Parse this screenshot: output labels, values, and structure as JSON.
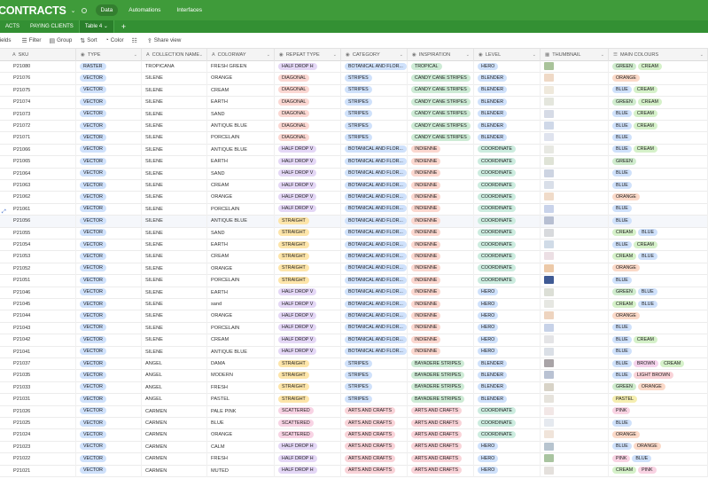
{
  "app": {
    "title": "CONTRACTS",
    "tabs": [
      "Data",
      "Automations",
      "Interfaces"
    ],
    "active_tab": "Data"
  },
  "tables": {
    "items": [
      "ACTS",
      "PAYING CLIENTS",
      "Table 4"
    ],
    "selected": "Table 4",
    "add_label": "+"
  },
  "toolbar": {
    "fields": "fields",
    "filter": "Filter",
    "group": "Group",
    "sort": "Sort",
    "color": "Color",
    "share": "Share view"
  },
  "columns": [
    {
      "key": "sku",
      "label": "SKU",
      "icon": "A"
    },
    {
      "key": "type",
      "label": "TYPE",
      "icon": "◉"
    },
    {
      "key": "collection",
      "label": "COLLECTION NAME",
      "icon": "A"
    },
    {
      "key": "colorway",
      "label": "COLORWAY",
      "icon": "A"
    },
    {
      "key": "repeat",
      "label": "REPEAT TYPE",
      "icon": "◉"
    },
    {
      "key": "category",
      "label": "CATEGORY",
      "icon": "◉"
    },
    {
      "key": "inspiration",
      "label": "INSPIRATION",
      "icon": "◉"
    },
    {
      "key": "level",
      "label": "LEVEL",
      "icon": "◉"
    },
    {
      "key": "thumbnail",
      "label": "THUMBNAIL",
      "icon": "▦"
    },
    {
      "key": "colours",
      "label": "MAIN COLOURS",
      "icon": "☰"
    }
  ],
  "rows": [
    {
      "sku": "P21080",
      "type": "RASTER",
      "collection": "TROPICANA",
      "colorway": "FRESH GREEN",
      "repeat": "HALF DROP H",
      "category": "BOTANICAL AND FLOR...",
      "inspiration": "TROPICAL",
      "level": "HERO",
      "thumb": "#a9c39a",
      "colours": [
        "GREEN",
        "CREAM"
      ]
    },
    {
      "sku": "P21076",
      "type": "VECTOR",
      "collection": "SILENE",
      "colorway": "ORANGE",
      "repeat": "DIAGONAL",
      "category": "STRIPES",
      "inspiration": "CANDY CANE STRIPES",
      "level": "BLENDER",
      "thumb": "#efd9c6",
      "colours": [
        "ORANGE"
      ]
    },
    {
      "sku": "P21075",
      "type": "VECTOR",
      "collection": "SILENE",
      "colorway": "CREAM",
      "repeat": "DIAGONAL",
      "category": "STRIPES",
      "inspiration": "CANDY CANE STRIPES",
      "level": "BLENDER",
      "thumb": "#efe9dc",
      "colours": [
        "BLUE",
        "CREAM"
      ]
    },
    {
      "sku": "P21074",
      "type": "VECTOR",
      "collection": "SILENE",
      "colorway": "EARTH",
      "repeat": "DIAGONAL",
      "category": "STRIPES",
      "inspiration": "CANDY CANE STRIPES",
      "level": "BLENDER",
      "thumb": "#e4e6dd",
      "colours": [
        "GREEN",
        "CREAM"
      ]
    },
    {
      "sku": "P21073",
      "type": "VECTOR",
      "collection": "SILENE",
      "colorway": "SAND",
      "repeat": "DIAGONAL",
      "category": "STRIPES",
      "inspiration": "CANDY CANE STRIPES",
      "level": "BLENDER",
      "thumb": "#d6dbe6",
      "colours": [
        "BLUE",
        "CREAM"
      ]
    },
    {
      "sku": "P21072",
      "type": "VECTOR",
      "collection": "SILENE",
      "colorway": "ANTIQUE BLUE",
      "repeat": "DIAGONAL",
      "category": "STRIPES",
      "inspiration": "CANDY CANE STRIPES",
      "level": "BLENDER",
      "thumb": "#cfd8e8",
      "colours": [
        "BLUE",
        "CREAM"
      ]
    },
    {
      "sku": "P21071",
      "type": "VECTOR",
      "collection": "SILENE",
      "colorway": "PORCELAIN",
      "repeat": "DIAGONAL",
      "category": "STRIPES",
      "inspiration": "CANDY CANE STRIPES",
      "level": "BLENDER",
      "thumb": "#dfe3ee",
      "colours": [
        "BLUE"
      ]
    },
    {
      "sku": "P21066",
      "type": "VECTOR",
      "collection": "SILENE",
      "colorway": "ANTIQUE BLUE",
      "repeat": "HALF DROP V",
      "category": "BOTANICAL AND FLOR...",
      "inspiration": "INDIENNE",
      "level": "COORDINATE",
      "thumb": "#e7e8e2",
      "colours": [
        "BLUE",
        "CREAM"
      ]
    },
    {
      "sku": "P21065",
      "type": "VECTOR",
      "collection": "SILENE",
      "colorway": "EARTH",
      "repeat": "HALF DROP V",
      "category": "BOTANICAL AND FLOR...",
      "inspiration": "INDIENNE",
      "level": "COORDINATE",
      "thumb": "#dfe3d6",
      "colours": [
        "GREEN"
      ]
    },
    {
      "sku": "P21064",
      "type": "VECTOR",
      "collection": "SILENE",
      "colorway": "SAND",
      "repeat": "HALF DROP V",
      "category": "BOTANICAL AND FLOR...",
      "inspiration": "INDIENNE",
      "level": "COORDINATE",
      "thumb": "#cdd4e2",
      "colours": [
        "BLUE"
      ]
    },
    {
      "sku": "P21063",
      "type": "VECTOR",
      "collection": "SILENE",
      "colorway": "CREAM",
      "repeat": "HALF DROP V",
      "category": "BOTANICAL AND FLOR...",
      "inspiration": "INDIENNE",
      "level": "COORDINATE",
      "thumb": "#d9dfe9",
      "colours": [
        "BLUE"
      ]
    },
    {
      "sku": "P21062",
      "type": "VECTOR",
      "collection": "SILENE",
      "colorway": "ORANGE",
      "repeat": "HALF DROP V",
      "category": "BOTANICAL AND FLOR...",
      "inspiration": "INDIENNE",
      "level": "COORDINATE",
      "thumb": "#f0dbc9",
      "colours": [
        "ORANGE"
      ]
    },
    {
      "sku": "P21061",
      "type": "VECTOR",
      "collection": "SILENE",
      "colorway": "PORCELAIN",
      "repeat": "HALF DROP V",
      "category": "BOTANICAL AND FLOR...",
      "inspiration": "INDIENNE",
      "level": "COORDINATE",
      "thumb": "#c9d3ea",
      "colours": [
        "BLUE"
      ]
    },
    {
      "sku": "P21056",
      "type": "VECTOR",
      "collection": "SILENE",
      "colorway": "ANTIQUE BLUE",
      "repeat": "STRAIGHT",
      "category": "BOTANICAL AND FLOR...",
      "inspiration": "INDIENNE",
      "level": "COORDINATE",
      "thumb": "#b7bfd2",
      "colours": [
        "BLUE"
      ]
    },
    {
      "sku": "P21055",
      "type": "VECTOR",
      "collection": "SILENE",
      "colorway": "SAND",
      "repeat": "STRAIGHT",
      "category": "BOTANICAL AND FLOR...",
      "inspiration": "INDIENNE",
      "level": "COORDINATE",
      "thumb": "#d8dadd",
      "colours": [
        "CREAM",
        "BLUE"
      ]
    },
    {
      "sku": "P21054",
      "type": "VECTOR",
      "collection": "SILENE",
      "colorway": "EARTH",
      "repeat": "STRAIGHT",
      "category": "BOTANICAL AND FLOR...",
      "inspiration": "INDIENNE",
      "level": "COORDINATE",
      "thumb": "#d0dbe7",
      "colours": [
        "BLUE",
        "CREAM"
      ]
    },
    {
      "sku": "P21053",
      "type": "VECTOR",
      "collection": "SILENE",
      "colorway": "CREAM",
      "repeat": "STRAIGHT",
      "category": "BOTANICAL AND FLOR...",
      "inspiration": "INDIENNE",
      "level": "COORDINATE",
      "thumb": "#ecdfe4",
      "colours": [
        "CREAM",
        "BLUE"
      ]
    },
    {
      "sku": "P21052",
      "type": "VECTOR",
      "collection": "SILENE",
      "colorway": "ORANGE",
      "repeat": "STRAIGHT",
      "category": "BOTANICAL AND FLOR...",
      "inspiration": "INDIENNE",
      "level": "COORDINATE",
      "thumb": "#ecc9a8",
      "colours": [
        "ORANGE"
      ]
    },
    {
      "sku": "P21051",
      "type": "VECTOR",
      "collection": "SILENE",
      "colorway": "PORCELAIN",
      "repeat": "STRAIGHT",
      "category": "BOTANICAL AND FLOR...",
      "inspiration": "INDIENNE",
      "level": "COORDINATE",
      "thumb": "#3f5a94",
      "colours": [
        "BLUE"
      ]
    },
    {
      "sku": "P21046",
      "type": "VECTOR",
      "collection": "SILENE",
      "colorway": "EARTH",
      "repeat": "HALF DROP V",
      "category": "BOTANICAL AND FLOR...",
      "inspiration": "INDIENNE",
      "level": "HERO",
      "thumb": "#dcdfd6",
      "colours": [
        "GREEN",
        "BLUE"
      ]
    },
    {
      "sku": "P21045",
      "type": "VECTOR",
      "collection": "SILENE",
      "colorway": "sand",
      "repeat": "HALF DROP V",
      "category": "BOTANICAL AND FLOR...",
      "inspiration": "INDIENNE",
      "level": "HERO",
      "thumb": "#e6e7e2",
      "colours": [
        "CREAM",
        "BLUE"
      ]
    },
    {
      "sku": "P21044",
      "type": "VECTOR",
      "collection": "SILENE",
      "colorway": "ORANGE",
      "repeat": "HALF DROP V",
      "category": "BOTANICAL AND FLOR...",
      "inspiration": "INDIENNE",
      "level": "HERO",
      "thumb": "#eed4bf",
      "colours": [
        "ORANGE"
      ]
    },
    {
      "sku": "P21043",
      "type": "VECTOR",
      "collection": "SILENE",
      "colorway": "PORCELAIN",
      "repeat": "HALF DROP V",
      "category": "BOTANICAL AND FLOR...",
      "inspiration": "INDIENNE",
      "level": "HERO",
      "thumb": "#c7d2e8",
      "colours": [
        "BLUE"
      ]
    },
    {
      "sku": "P21042",
      "type": "VECTOR",
      "collection": "SILENE",
      "colorway": "CREAM",
      "repeat": "HALF DROP V",
      "category": "BOTANICAL AND FLOR...",
      "inspiration": "INDIENNE",
      "level": "HERO",
      "thumb": "#e4e4e6",
      "colours": [
        "BLUE",
        "CREAM"
      ]
    },
    {
      "sku": "P21041",
      "type": "VECTOR",
      "collection": "SILENE",
      "colorway": "ANTIQUE BLUE",
      "repeat": "HALF DROP V",
      "category": "BOTANICAL AND FLOR...",
      "inspiration": "INDIENNE",
      "level": "HERO",
      "thumb": "#dadfe6",
      "colours": [
        "BLUE"
      ]
    },
    {
      "sku": "P21037",
      "type": "VECTOR",
      "collection": "ANGEL",
      "colorway": "DAMA",
      "repeat": "STRAIGHT",
      "category": "STRIPES",
      "inspiration": "BAYADERE STRIPES",
      "level": "BLENDER",
      "thumb": "#a9a4a7",
      "colours": [
        "BLUE",
        "BROWN",
        "CREAM"
      ]
    },
    {
      "sku": "P21035",
      "type": "VECTOR",
      "collection": "ANGEL",
      "colorway": "MODERN",
      "repeat": "STRAIGHT",
      "category": "STRIPES",
      "inspiration": "BAYADERE STRIPES",
      "level": "BLENDER",
      "thumb": "#b9c2d3",
      "colours": [
        "BLUE",
        "LIGHT BROWN"
      ]
    },
    {
      "sku": "P21033",
      "type": "VECTOR",
      "collection": "ANGEL",
      "colorway": "FRESH",
      "repeat": "STRAIGHT",
      "category": "STRIPES",
      "inspiration": "BAYADERE STRIPES",
      "level": "BLENDER",
      "thumb": "#d8d3c7",
      "colours": [
        "GREEN",
        "ORANGE"
      ]
    },
    {
      "sku": "P21031",
      "type": "VECTOR",
      "collection": "ANGEL",
      "colorway": "PASTEL",
      "repeat": "STRAIGHT",
      "category": "STRIPES",
      "inspiration": "BAYADERE STRIPES",
      "level": "BLENDER",
      "thumb": "#e6e3dc",
      "colours": [
        "PASTEL"
      ]
    },
    {
      "sku": "P21026",
      "type": "VECTOR",
      "collection": "CARMEN",
      "colorway": "PALE PINK",
      "repeat": "SCATTERED",
      "category": "ARTS AND CRAFTS",
      "inspiration": "ARTS AND CRAFTS",
      "level": "COORDINATE",
      "thumb": "#f2e7e6",
      "colours": [
        "PINK"
      ]
    },
    {
      "sku": "P21025",
      "type": "VECTOR",
      "collection": "CARMEN",
      "colorway": "BLUE",
      "repeat": "SCATTERED",
      "category": "ARTS AND CRAFTS",
      "inspiration": "ARTS AND CRAFTS",
      "level": "COORDINATE",
      "thumb": "#e5e9ef",
      "colours": [
        "BLUE"
      ]
    },
    {
      "sku": "P21024",
      "type": "VECTOR",
      "collection": "CARMEN",
      "colorway": "ORANGE",
      "repeat": "SCATTERED",
      "category": "ARTS AND CRAFTS",
      "inspiration": "ARTS AND CRAFTS",
      "level": "COORDINATE",
      "thumb": "#f0e4da",
      "colours": [
        "ORANGE"
      ]
    },
    {
      "sku": "P21023",
      "type": "VECTOR",
      "collection": "CARMEN",
      "colorway": "CALM",
      "repeat": "HALF DROP H",
      "category": "ARTS AND CRAFTS",
      "inspiration": "ARTS AND CRAFTS",
      "level": "HERO",
      "thumb": "#b7c4cf",
      "colours": [
        "BLUE",
        "ORANGE"
      ]
    },
    {
      "sku": "P21022",
      "type": "VECTOR",
      "collection": "CARMEN",
      "colorway": "FRESH",
      "repeat": "HALF DROP H",
      "category": "ARTS AND CRAFTS",
      "inspiration": "ARTS AND CRAFTS",
      "level": "HERO",
      "thumb": "#a9c4a0",
      "colours": [
        "PINK",
        "BLUE"
      ]
    },
    {
      "sku": "P21021",
      "type": "VECTOR",
      "collection": "CARMEN",
      "colorway": "MUTED",
      "repeat": "HALF DROP H",
      "category": "ARTS AND CRAFTS",
      "inspiration": "ARTS AND CRAFTS",
      "level": "HERO",
      "thumb": "#e4e0dc",
      "colours": [
        "CREAM",
        "PINK"
      ]
    }
  ]
}
